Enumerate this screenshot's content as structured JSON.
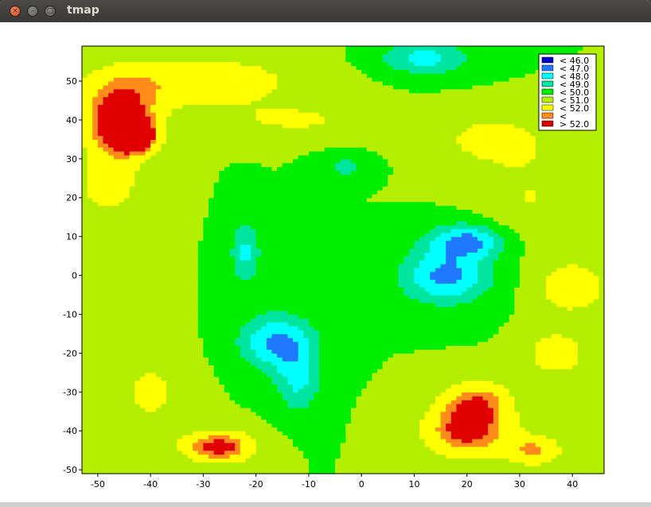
{
  "window": {
    "title": "tmap",
    "close_glyph": "×",
    "minimize_glyph": "–",
    "maximize_glyph": "□"
  },
  "chart_data": {
    "type": "heatmap",
    "title": "",
    "xlabel": "",
    "ylabel": "",
    "xlim": [
      -53,
      46
    ],
    "ylim": [
      -51,
      59
    ],
    "xticks": [
      -50,
      -40,
      -30,
      -20,
      -10,
      0,
      10,
      20,
      30,
      40
    ],
    "yticks": [
      -50,
      -40,
      -30,
      -20,
      -10,
      0,
      10,
      20,
      30,
      40,
      50
    ],
    "baseline_value": 50.0,
    "legend_position": "top-right",
    "legend": [
      {
        "label": "< 46.0",
        "color": "#0000cc"
      },
      {
        "label": "< 47.0",
        "color": "#1f78ff"
      },
      {
        "label": "< 48.0",
        "color": "#00ffff"
      },
      {
        "label": "< 49.0",
        "color": "#00e6a0"
      },
      {
        "label": "< 50.0",
        "color": "#00ee00"
      },
      {
        "label": "< 51.0",
        "color": "#b4ee00"
      },
      {
        "label": "< 52.0",
        "color": "#ffff00"
      },
      {
        "label": "<",
        "color": "#ff8c1a"
      },
      {
        "label": "> 52.0",
        "color": "#e00000"
      }
    ],
    "features": [
      {
        "x": -46,
        "y": 40,
        "value": 53.3,
        "sx": 5,
        "sy": 7
      },
      {
        "x": -43,
        "y": 36,
        "value": 52.8,
        "sx": 3,
        "sy": 3
      },
      {
        "x": -27,
        "y": -44,
        "value": 53.0,
        "sx": 5,
        "sy": 3
      },
      {
        "x": 20,
        "y": -40,
        "value": 52.9,
        "sx": 6,
        "sy": 5
      },
      {
        "x": 22,
        "y": -32,
        "value": 52.0,
        "sx": 5,
        "sy": 4
      },
      {
        "x": 33,
        "y": -45,
        "value": 52.0,
        "sx": 4,
        "sy": 3
      },
      {
        "x": 16,
        "y": 0,
        "value": 46.7,
        "sx": 6,
        "sy": 5
      },
      {
        "x": 20,
        "y": 9,
        "value": 46.8,
        "sx": 5,
        "sy": 3
      },
      {
        "x": -16,
        "y": -17,
        "value": 46.8,
        "sx": 5,
        "sy": 5
      },
      {
        "x": -12,
        "y": -27,
        "value": 47.9,
        "sx": 3,
        "sy": 6
      },
      {
        "x": 12,
        "y": 56,
        "value": 47.6,
        "sx": 6,
        "sy": 3
      },
      {
        "x": -22,
        "y": 6,
        "value": 47.8,
        "sx": 2,
        "sy": 6
      },
      {
        "x": -3,
        "y": 28,
        "value": 48.6,
        "sx": 3,
        "sy": 2
      },
      {
        "x": -31,
        "y": 50,
        "value": 51.8,
        "sx": 14,
        "sy": 5
      },
      {
        "x": -12,
        "y": 40,
        "value": 51.1,
        "sx": 10,
        "sy": 3
      },
      {
        "x": 25,
        "y": 35,
        "value": 51.4,
        "sx": 8,
        "sy": 5
      },
      {
        "x": 40,
        "y": -3,
        "value": 51.8,
        "sx": 5,
        "sy": 5
      },
      {
        "x": 37,
        "y": -20,
        "value": 51.8,
        "sx": 4,
        "sy": 4
      },
      {
        "x": -40,
        "y": -30,
        "value": 51.2,
        "sx": 5,
        "sy": 8
      },
      {
        "x": 32,
        "y": 20,
        "value": 51.0,
        "sx": 6,
        "sy": 8
      },
      {
        "x": -48,
        "y": 22,
        "value": 51.3,
        "sx": 5,
        "sy": 6
      }
    ]
  }
}
